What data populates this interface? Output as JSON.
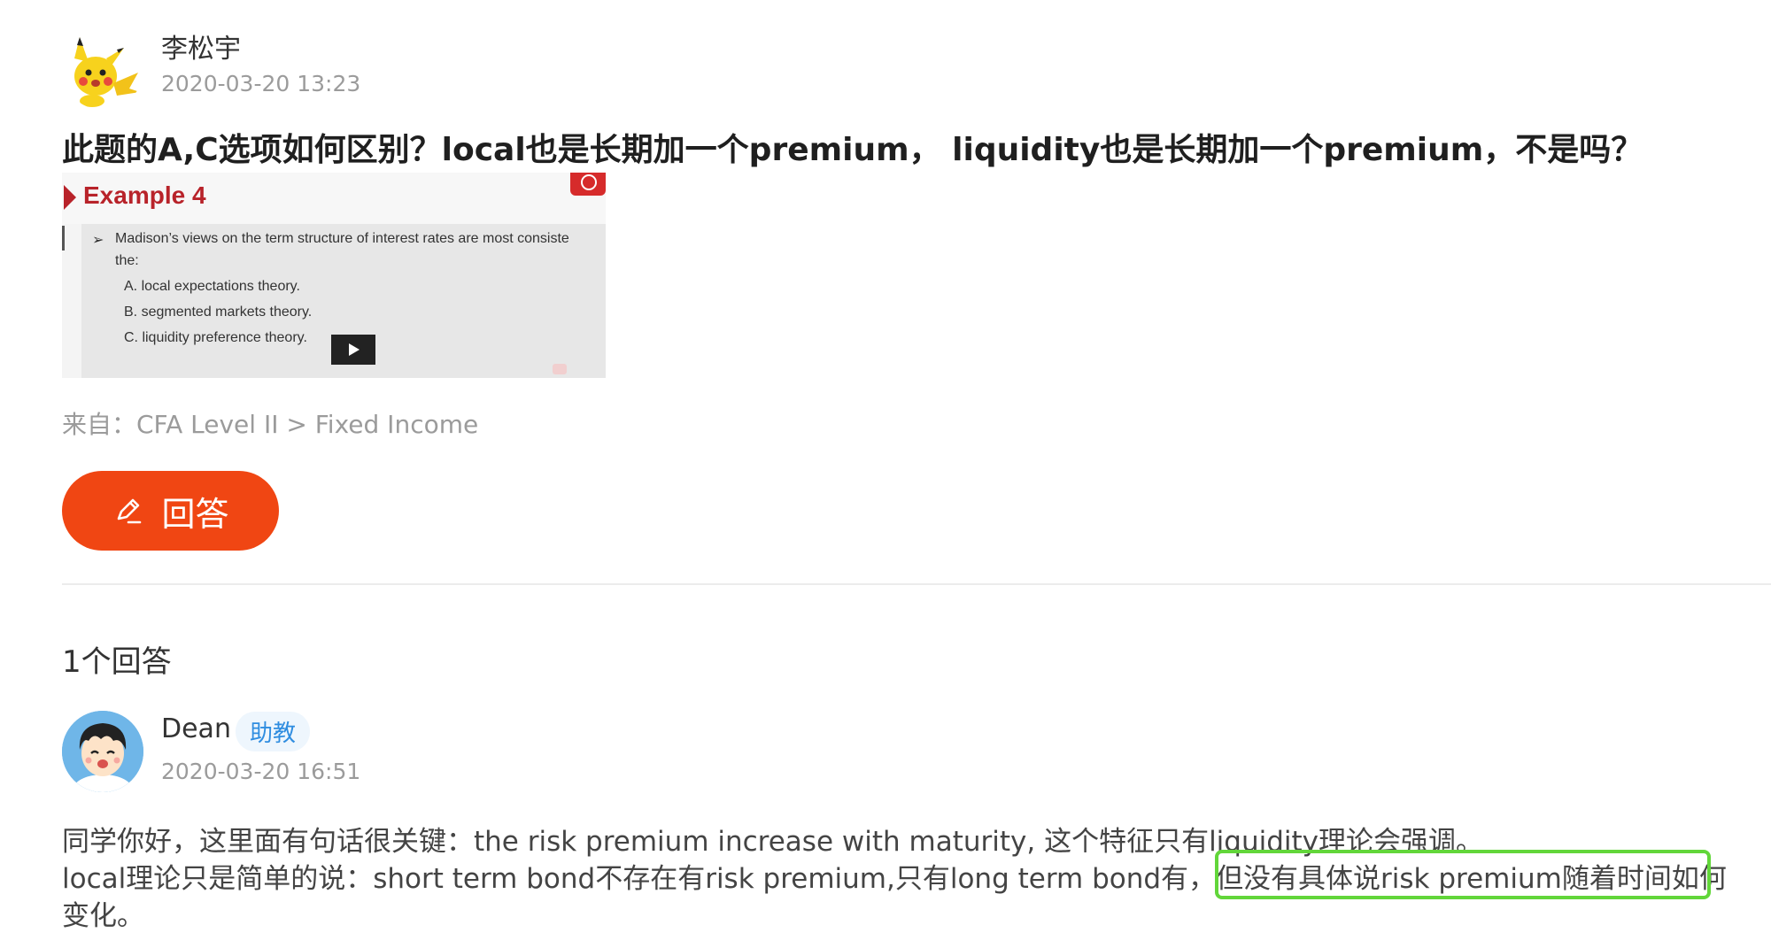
{
  "question": {
    "author": "李松宇",
    "time": "2020-03-20 13:23",
    "title": "此题的A,C选项如何区别？local也是长期加一个premium， liquidity也是长期加一个premium，不是吗？",
    "image": {
      "title": "Example 4",
      "stem_line1": "Madison’s views on the term structure of interest rates are most consiste",
      "stem_line2": "the:",
      "options": [
        "A.   local expectations theory.",
        "B.   segmented markets theory.",
        "C.   liquidity preference theory."
      ]
    },
    "source": "来自：CFA Level II > Fixed Income",
    "answer_button_label": "回答"
  },
  "answers_section": {
    "count_label": "1个回答"
  },
  "answer": {
    "author": "Dean",
    "role": "助教",
    "time": "2020-03-20 16:51",
    "line1": "同学你好，这里面有句话很关键：the risk premium increase with maturity, 这个特征只有liquidity理论会强调。",
    "line2": "local理论只是简单的说：short term bond不存在有risk premium,只有long term bond有，但没有具体说risk premium随着时间如何",
    "line3": "变化。"
  },
  "colors": {
    "accent": "#f04613",
    "badge_text": "#2f8de0",
    "highlight": "#62d63a"
  },
  "icons": [
    "pikachu-avatar",
    "pencil-icon",
    "play-icon",
    "cartoon-avatar"
  ]
}
